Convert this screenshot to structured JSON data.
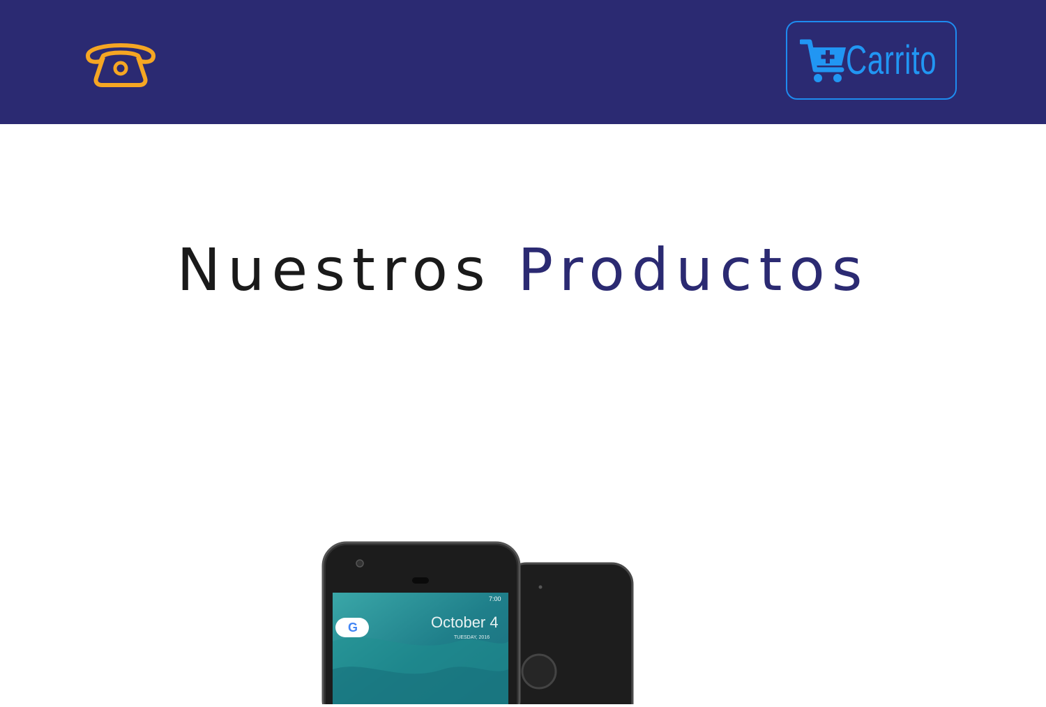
{
  "header": {
    "background_color": "#2b2a72",
    "phone_icon": "telephone-icon",
    "phone_icon_color": "#f5a623",
    "cart": {
      "icon": "cart-plus-icon",
      "label": "Carrito",
      "color": "#2196f3"
    }
  },
  "main": {
    "title_part1": "Nuestros",
    "title_part2": "Productos",
    "title_accent_color": "#2b2a72",
    "products": [
      {
        "image_icon": "smartphone-image",
        "screen_date": "October 4",
        "screen_day": "TUESDAY, 2016",
        "status_time": "7:00"
      }
    ]
  }
}
